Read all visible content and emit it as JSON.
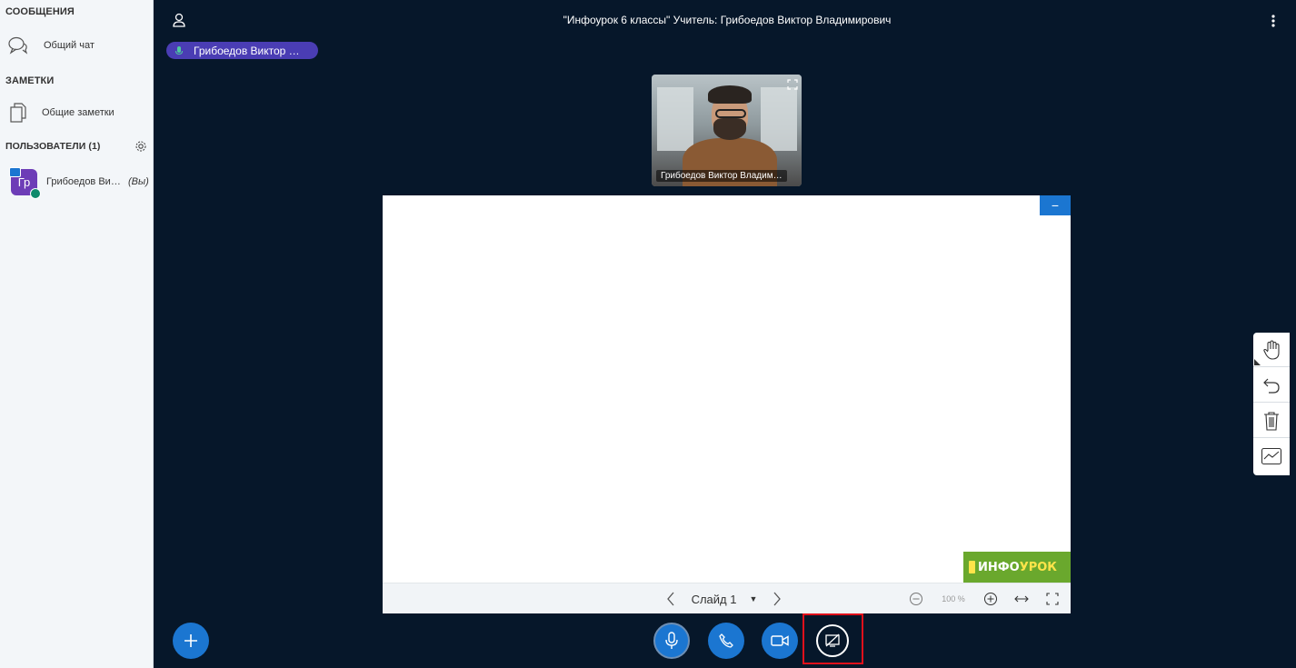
{
  "sidebar": {
    "messages_title": "СООБЩЕНИЯ",
    "public_chat": "Общий чат",
    "notes_title": "ЗАМЕТКИ",
    "shared_notes": "Общие заметки",
    "users_title": "ПОЛЬЗОВАТЕЛИ (1)",
    "users": [
      {
        "initials": "Гр",
        "name": "Грибоедов Ви…",
        "you": "(Вы)"
      }
    ]
  },
  "header": {
    "title": "\"Инфоурок 6 классы\" Учитель: Грибоедов Виктор Владимирович"
  },
  "talking": {
    "name": "Грибоедов Виктор …"
  },
  "webcam": {
    "label": "Грибоедов Виктор Владим…"
  },
  "presentation": {
    "logo_part1": "ИНФО",
    "logo_part2": "УРОК",
    "slide_label": "Слайд 1",
    "zoom": "100 %",
    "minimize_symbol": "−"
  },
  "colors": {
    "background": "#06172A",
    "accent": "#1B76D1",
    "talking_pill": "#4A3DB4",
    "highlight": "#E0101B",
    "logo_green": "#6AA82D"
  }
}
